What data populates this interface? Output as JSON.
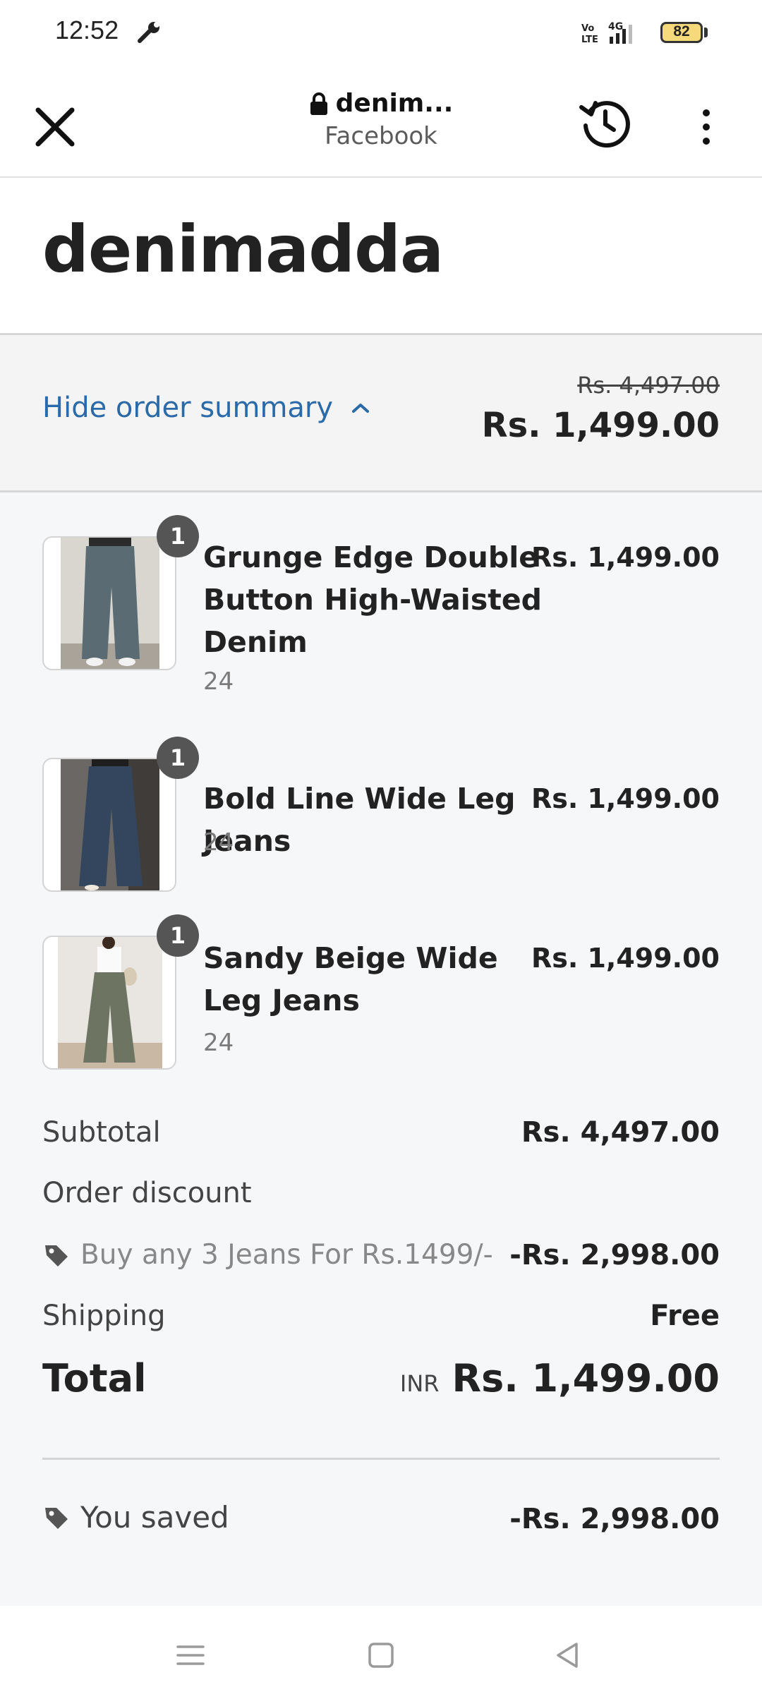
{
  "status_bar": {
    "time": "12:52",
    "battery": "82",
    "network": "4G"
  },
  "browser": {
    "url": "denim...",
    "subtitle": "Facebook"
  },
  "store": {
    "name": "denimadda"
  },
  "summary_toggle": {
    "label": "Hide order summary",
    "original_total": "Rs. 4,497.00",
    "total": "Rs. 1,499.00"
  },
  "items": [
    {
      "name": "Grunge Edge Double Button High-Waisted Denim",
      "variant": "24",
      "quantity": "1",
      "price": "Rs. 1,499.00"
    },
    {
      "name": "Bold Line Wide Leg Jeans",
      "variant": "24",
      "quantity": "1",
      "price": "Rs. 1,499.00"
    },
    {
      "name": "Sandy Beige Wide Leg Jeans",
      "variant": "24",
      "quantity": "1",
      "price": "Rs. 1,499.00"
    }
  ],
  "totals": {
    "subtotal_label": "Subtotal",
    "subtotal": "Rs. 4,497.00",
    "discount_label": "Order discount",
    "discount_code": "Buy any 3 Jeans For Rs.1499/-",
    "discount_amount": "-Rs. 2,998.00",
    "shipping_label": "Shipping",
    "shipping": "Free",
    "total_label": "Total",
    "currency": "INR",
    "total": "Rs. 1,499.00",
    "saved_label": "You saved",
    "saved": "-Rs. 2,998.00"
  },
  "colors": {
    "link": "#2a6aa8",
    "summary_bg": "#f6f7f9",
    "badge": "#555555"
  }
}
